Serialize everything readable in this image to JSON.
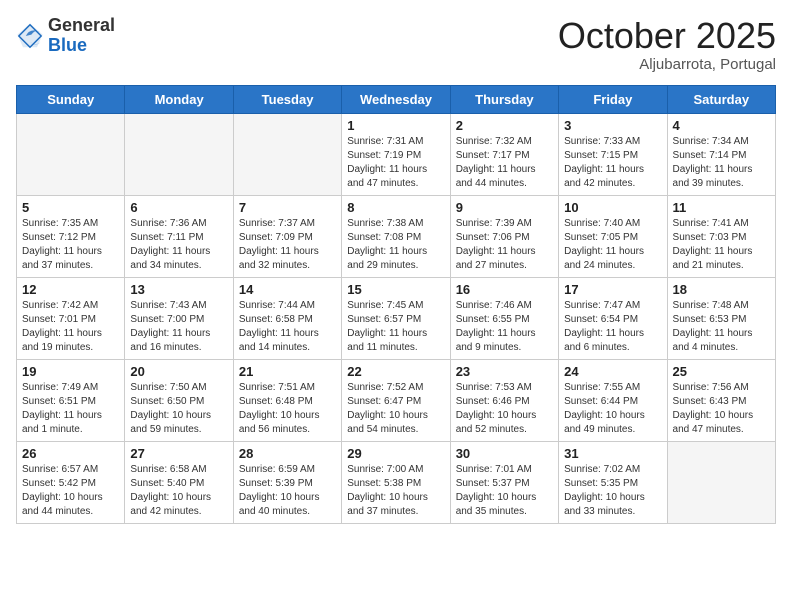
{
  "header": {
    "logo_general": "General",
    "logo_blue": "Blue",
    "month_title": "October 2025",
    "location": "Aljubarrota, Portugal"
  },
  "days_of_week": [
    "Sunday",
    "Monday",
    "Tuesday",
    "Wednesday",
    "Thursday",
    "Friday",
    "Saturday"
  ],
  "weeks": [
    [
      {
        "day": "",
        "info": ""
      },
      {
        "day": "",
        "info": ""
      },
      {
        "day": "",
        "info": ""
      },
      {
        "day": "1",
        "info": "Sunrise: 7:31 AM\nSunset: 7:19 PM\nDaylight: 11 hours\nand 47 minutes."
      },
      {
        "day": "2",
        "info": "Sunrise: 7:32 AM\nSunset: 7:17 PM\nDaylight: 11 hours\nand 44 minutes."
      },
      {
        "day": "3",
        "info": "Sunrise: 7:33 AM\nSunset: 7:15 PM\nDaylight: 11 hours\nand 42 minutes."
      },
      {
        "day": "4",
        "info": "Sunrise: 7:34 AM\nSunset: 7:14 PM\nDaylight: 11 hours\nand 39 minutes."
      }
    ],
    [
      {
        "day": "5",
        "info": "Sunrise: 7:35 AM\nSunset: 7:12 PM\nDaylight: 11 hours\nand 37 minutes."
      },
      {
        "day": "6",
        "info": "Sunrise: 7:36 AM\nSunset: 7:11 PM\nDaylight: 11 hours\nand 34 minutes."
      },
      {
        "day": "7",
        "info": "Sunrise: 7:37 AM\nSunset: 7:09 PM\nDaylight: 11 hours\nand 32 minutes."
      },
      {
        "day": "8",
        "info": "Sunrise: 7:38 AM\nSunset: 7:08 PM\nDaylight: 11 hours\nand 29 minutes."
      },
      {
        "day": "9",
        "info": "Sunrise: 7:39 AM\nSunset: 7:06 PM\nDaylight: 11 hours\nand 27 minutes."
      },
      {
        "day": "10",
        "info": "Sunrise: 7:40 AM\nSunset: 7:05 PM\nDaylight: 11 hours\nand 24 minutes."
      },
      {
        "day": "11",
        "info": "Sunrise: 7:41 AM\nSunset: 7:03 PM\nDaylight: 11 hours\nand 21 minutes."
      }
    ],
    [
      {
        "day": "12",
        "info": "Sunrise: 7:42 AM\nSunset: 7:01 PM\nDaylight: 11 hours\nand 19 minutes."
      },
      {
        "day": "13",
        "info": "Sunrise: 7:43 AM\nSunset: 7:00 PM\nDaylight: 11 hours\nand 16 minutes."
      },
      {
        "day": "14",
        "info": "Sunrise: 7:44 AM\nSunset: 6:58 PM\nDaylight: 11 hours\nand 14 minutes."
      },
      {
        "day": "15",
        "info": "Sunrise: 7:45 AM\nSunset: 6:57 PM\nDaylight: 11 hours\nand 11 minutes."
      },
      {
        "day": "16",
        "info": "Sunrise: 7:46 AM\nSunset: 6:55 PM\nDaylight: 11 hours\nand 9 minutes."
      },
      {
        "day": "17",
        "info": "Sunrise: 7:47 AM\nSunset: 6:54 PM\nDaylight: 11 hours\nand 6 minutes."
      },
      {
        "day": "18",
        "info": "Sunrise: 7:48 AM\nSunset: 6:53 PM\nDaylight: 11 hours\nand 4 minutes."
      }
    ],
    [
      {
        "day": "19",
        "info": "Sunrise: 7:49 AM\nSunset: 6:51 PM\nDaylight: 11 hours\nand 1 minute."
      },
      {
        "day": "20",
        "info": "Sunrise: 7:50 AM\nSunset: 6:50 PM\nDaylight: 10 hours\nand 59 minutes."
      },
      {
        "day": "21",
        "info": "Sunrise: 7:51 AM\nSunset: 6:48 PM\nDaylight: 10 hours\nand 56 minutes."
      },
      {
        "day": "22",
        "info": "Sunrise: 7:52 AM\nSunset: 6:47 PM\nDaylight: 10 hours\nand 54 minutes."
      },
      {
        "day": "23",
        "info": "Sunrise: 7:53 AM\nSunset: 6:46 PM\nDaylight: 10 hours\nand 52 minutes."
      },
      {
        "day": "24",
        "info": "Sunrise: 7:55 AM\nSunset: 6:44 PM\nDaylight: 10 hours\nand 49 minutes."
      },
      {
        "day": "25",
        "info": "Sunrise: 7:56 AM\nSunset: 6:43 PM\nDaylight: 10 hours\nand 47 minutes."
      }
    ],
    [
      {
        "day": "26",
        "info": "Sunrise: 6:57 AM\nSunset: 5:42 PM\nDaylight: 10 hours\nand 44 minutes."
      },
      {
        "day": "27",
        "info": "Sunrise: 6:58 AM\nSunset: 5:40 PM\nDaylight: 10 hours\nand 42 minutes."
      },
      {
        "day": "28",
        "info": "Sunrise: 6:59 AM\nSunset: 5:39 PM\nDaylight: 10 hours\nand 40 minutes."
      },
      {
        "day": "29",
        "info": "Sunrise: 7:00 AM\nSunset: 5:38 PM\nDaylight: 10 hours\nand 37 minutes."
      },
      {
        "day": "30",
        "info": "Sunrise: 7:01 AM\nSunset: 5:37 PM\nDaylight: 10 hours\nand 35 minutes."
      },
      {
        "day": "31",
        "info": "Sunrise: 7:02 AM\nSunset: 5:35 PM\nDaylight: 10 hours\nand 33 minutes."
      },
      {
        "day": "",
        "info": ""
      }
    ]
  ]
}
